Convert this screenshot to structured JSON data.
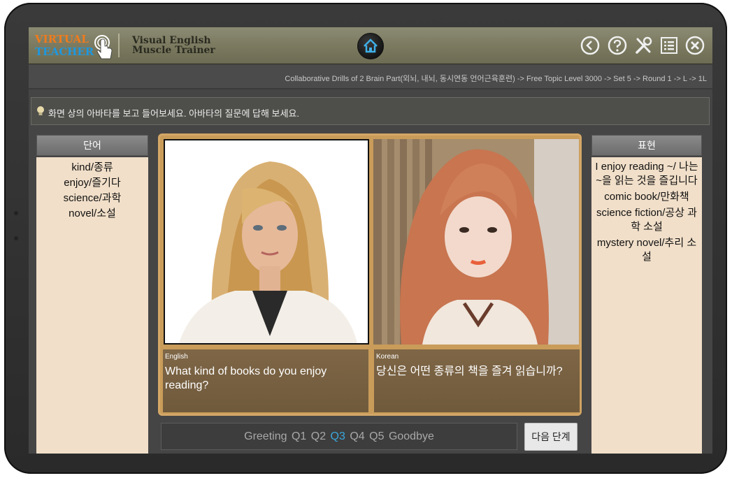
{
  "header": {
    "logo_line1": "VIRTUAL",
    "logo_line2": "TEACHER",
    "title_line1": "Visual English",
    "title_line2": "Muscle Trainer",
    "icons": [
      "home-icon",
      "back-icon",
      "help-icon",
      "settings-tools-icon",
      "list-icon",
      "close-icon"
    ]
  },
  "breadcrumb": "Collaborative Drills of 2 Brain Part(외뇌, 내뇌, 동시연동 언어근육훈련) -> Free Topic Level 3000 -> Set 5 ->  Round 1 -> L -> 1L",
  "instruction": "화면 상의 아바타를 보고 들어보세요. 아바타의 질문에 답해 보세요.",
  "vocab": {
    "title": "단어",
    "items": [
      "kind/종류",
      "enjoy/즐기다",
      "science/과학",
      "novel/소설"
    ]
  },
  "expressions": {
    "title": "표현",
    "items": [
      "I enjoy reading ~/ 나는 ~을 읽는 것을 즐깁니다",
      "comic book/만화책",
      "science fiction/공상 과학 소설",
      "mystery novel/추리 소설"
    ]
  },
  "dialogue": {
    "english_label": "English",
    "english_text": "What kind of books do you enjoy reading?",
    "korean_label": "Korean",
    "korean_text": "당신은 어떤 종류의 책을 즐겨 읽습니까?"
  },
  "question_nav": {
    "items": [
      "Greeting",
      "Q1",
      "Q2",
      "Q3",
      "Q4",
      "Q5",
      "Goodbye"
    ],
    "active": "Q3"
  },
  "next_button": "다음 단계",
  "colors": {
    "logo_orange": "#f07b1c",
    "logo_blue": "#1d98e0",
    "active_question": "#3aa6dc",
    "panel_bg": "#f1dfc9",
    "wood_frame": "#c99c5a"
  }
}
